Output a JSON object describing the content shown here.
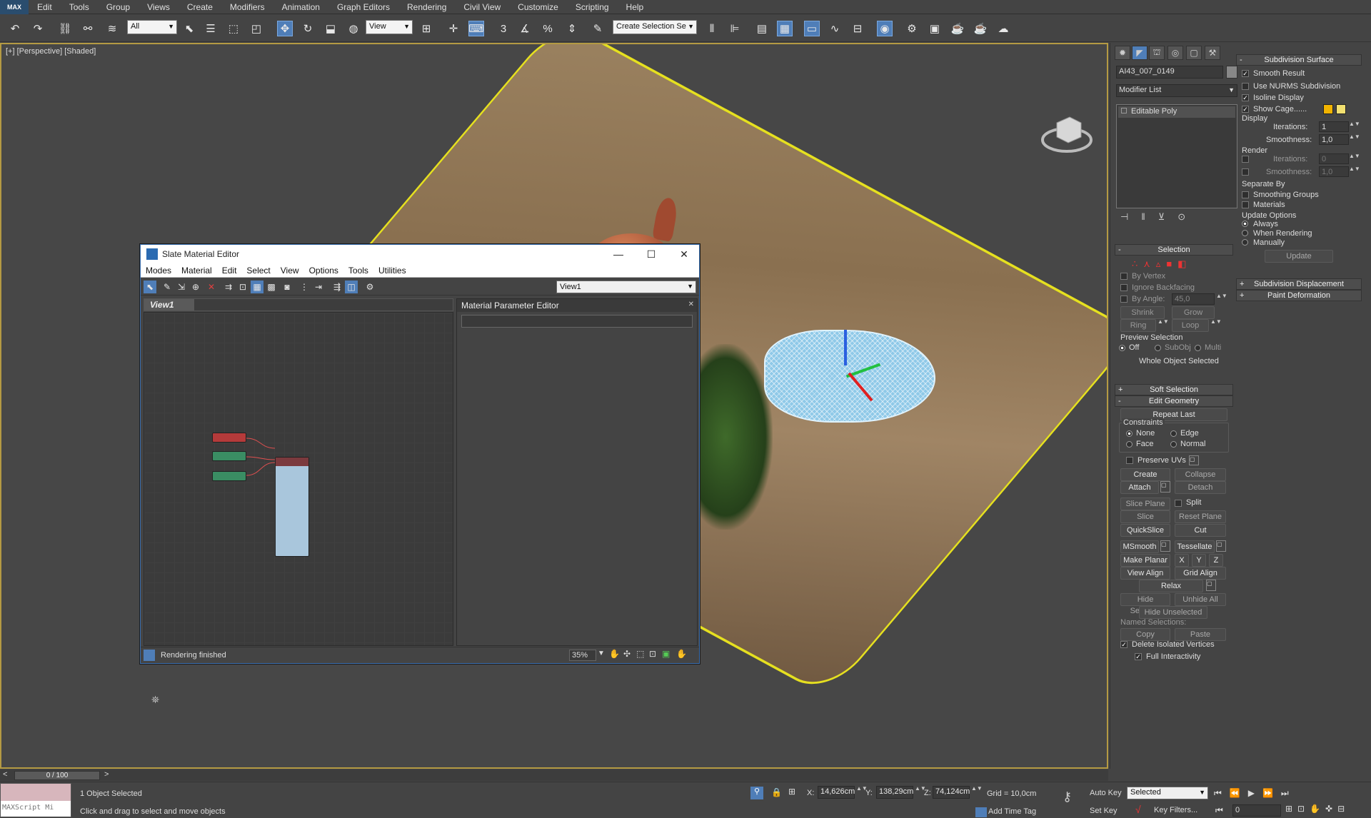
{
  "app": {
    "logo": "MAX"
  },
  "menu": [
    "Edit",
    "Tools",
    "Group",
    "Views",
    "Create",
    "Modifiers",
    "Animation",
    "Graph Editors",
    "Rendering",
    "Civil View",
    "Customize",
    "Scripting",
    "Help"
  ],
  "toolbar": {
    "filter_select": "All",
    "ref_coord_select": "View",
    "named_selection": "Create Selection Se",
    "snaps": {
      "snap_3d": "3",
      "percent": "%"
    }
  },
  "viewport": {
    "label": "[+] [Perspective] [Shaded]"
  },
  "slate": {
    "title": "Slate Material Editor",
    "menu": [
      "Modes",
      "Material",
      "Edit",
      "Select",
      "View",
      "Options",
      "Tools",
      "Utilities"
    ],
    "view_select": "View1",
    "view_tab": "View1",
    "mpe_title": "Material Parameter Editor",
    "status": "Rendering finished",
    "zoom": "35%"
  },
  "command_panel": {
    "object_name": "AI43_007_0149",
    "modifier_list": "Modifier List",
    "stack_item": "Editable Poly",
    "selection": {
      "title": "Selection",
      "by_vertex": "By Vertex",
      "ignore_backfacing": "Ignore Backfacing",
      "by_angle": "By Angle:",
      "angle_value": "45,0",
      "shrink": "Shrink",
      "grow": "Grow",
      "ring": "Ring",
      "loop": "Loop",
      "preview_selection": "Preview Selection",
      "preview_off": "Off",
      "preview_subobj": "SubObj",
      "preview_multi": "Multi",
      "status": "Whole Object Selected"
    },
    "soft_selection": "Soft Selection",
    "edit_geometry": {
      "title": "Edit Geometry",
      "repeat_last": "Repeat Last",
      "constraints": "Constraints",
      "none": "None",
      "edge": "Edge",
      "face": "Face",
      "normal": "Normal",
      "preserve_uvs": "Preserve UVs",
      "create": "Create",
      "collapse": "Collapse",
      "attach": "Attach",
      "detach": "Detach",
      "slice_plane": "Slice Plane",
      "split": "Split",
      "slice": "Slice",
      "reset_plane": "Reset Plane",
      "quickslice": "QuickSlice",
      "cut": "Cut",
      "msmooth": "MSmooth",
      "tessellate": "Tessellate",
      "make_planar": "Make Planar",
      "x": "X",
      "y": "Y",
      "z": "Z",
      "view_align": "View Align",
      "grid_align": "Grid Align",
      "relax": "Relax",
      "hide_selected": "Hide Selected",
      "unhide_all": "Unhide All",
      "hide_unselected": "Hide Unselected",
      "named_selections": "Named Selections:",
      "copy": "Copy",
      "paste": "Paste",
      "delete_isolated": "Delete Isolated Vertices",
      "full_interactivity": "Full Interactivity"
    },
    "subdivision": {
      "title": "Subdivision Surface",
      "smooth_result": "Smooth Result",
      "use_nurms": "Use NURMS Subdivision",
      "isoline": "Isoline Display",
      "show_cage": "Show Cage......",
      "display": "Display",
      "iterations": "Iterations:",
      "display_iterations": "1",
      "smoothness": "Smoothness:",
      "display_smoothness": "1,0",
      "render": "Render",
      "render_iterations": "0",
      "render_smoothness": "1,0",
      "separate_by": "Separate By",
      "smoothing_groups": "Smoothing Groups",
      "materials": "Materials",
      "update_options": "Update Options",
      "always": "Always",
      "when_rendering": "When Rendering",
      "manually": "Manually",
      "update": "Update",
      "displacement": "Subdivision Displacement",
      "paint_deformation": "Paint Deformation"
    },
    "cage_colors": [
      "#f2b400",
      "#f2e070"
    ]
  },
  "time": {
    "slider": "0 / 100"
  },
  "status": {
    "maxscript_placeholder": "MAXScript Mi",
    "selection_info": "1 Object Selected",
    "prompt": "Click and drag to select and move objects",
    "x_label": "X:",
    "x": "14,626cm",
    "y_label": "Y:",
    "y": "138,29cm",
    "z_label": "Z:",
    "z": "74,124cm",
    "grid": "Grid = 10,0cm",
    "add_time_tag": "Add Time Tag",
    "auto_key": "Auto Key",
    "set_key": "Set Key",
    "key_mode": "Selected",
    "key_filters": "Key Filters...",
    "frame": "0"
  }
}
